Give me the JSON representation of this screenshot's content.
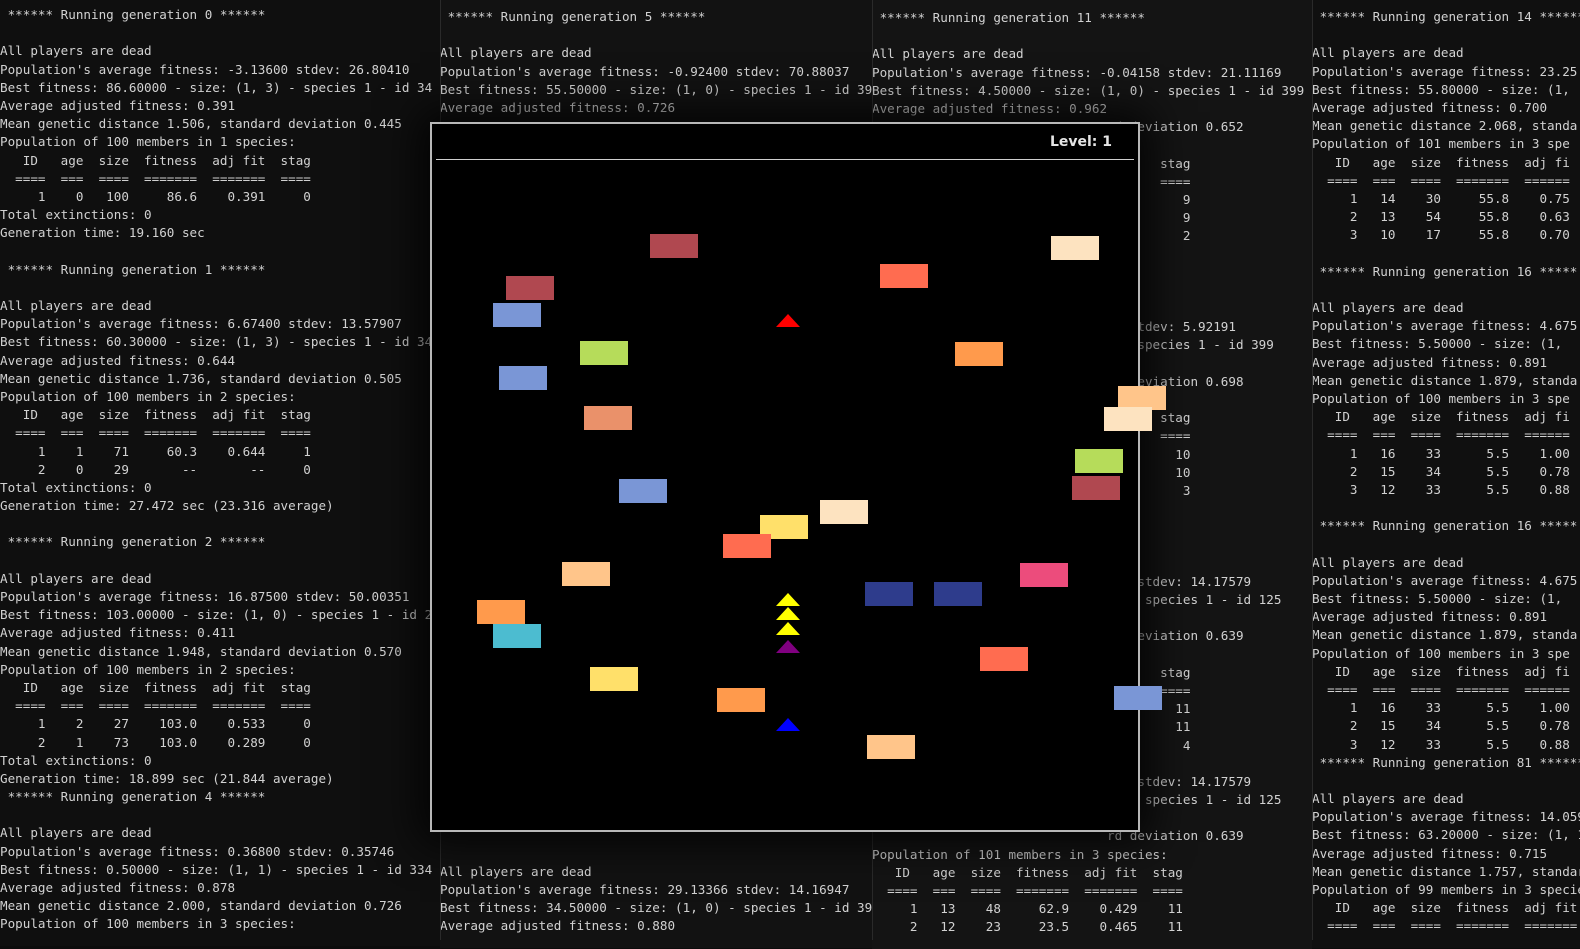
{
  "terminals": [
    {
      "lines": [
        " ****** Running generation 0 ******",
        "",
        "All players are dead",
        "Population's average fitness: -3.13600 stdev: 26.80410",
        "Best fitness: 86.60000 - size: (1, 3) - species 1 - id 34",
        "Average adjusted fitness: 0.391",
        "Mean genetic distance 1.506, standard deviation 0.445",
        "Population of 100 members in 1 species:",
        "   ID   age  size  fitness  adj fit  stag",
        "  ====  ===  ====  =======  =======  ====",
        "     1    0   100     86.6    0.391     0",
        "Total extinctions: 0",
        "Generation time: 19.160 sec",
        "",
        " ****** Running generation 1 ******",
        "",
        "All players are dead",
        "Population's average fitness: 6.67400 stdev: 13.57907",
        "Best fitness: 60.30000 - size: (1, 3) - species 1 - id 34",
        "Average adjusted fitness: 0.644",
        "Mean genetic distance 1.736, standard deviation 0.505",
        "Population of 100 members in 2 species:",
        "   ID   age  size  fitness  adj fit  stag",
        "  ====  ===  ====  =======  =======  ====",
        "     1    1    71     60.3    0.644     1",
        "     2    0    29       --       --     0",
        "Total extinctions: 0",
        "Generation time: 27.472 sec (23.316 average)",
        "",
        " ****** Running generation 2 ******",
        "",
        "All players are dead",
        "Population's average fitness: 16.87500 stdev: 50.00351",
        "Best fitness: 103.00000 - size: (1, 0) - species 1 - id 2",
        "Average adjusted fitness: 0.411",
        "Mean genetic distance 1.948, standard deviation 0.570",
        "Population of 100 members in 2 species:",
        "   ID   age  size  fitness  adj fit  stag",
        "  ====  ===  ====  =======  =======  ====",
        "     1    2    27    103.0    0.533     0",
        "     2    1    73    103.0    0.289     0",
        "Total extinctions: 0",
        "Generation time: 18.899 sec (21.844 average)",
        " ****** Running generation 4 ******",
        "",
        "All players are dead",
        "Population's average fitness: 0.36800 stdev: 0.35746",
        "Best fitness: 0.50000 - size: (1, 1) - species 1 - id 334",
        "Average adjusted fitness: 0.878",
        "Mean genetic distance 2.000, standard deviation 0.726",
        "Population of 100 members in 3 species:"
      ]
    },
    {
      "lines": [
        " ****** Running generation 5 ******",
        "",
        "All players are dead",
        "Population's average fitness: -0.92400 stdev: 70.88037",
        "Best fitness: 55.50000 - size: (1, 0) - species 1 - id 399",
        "Average adjusted fitness: 0.726",
        "",
        "",
        "",
        "",
        "",
        "",
        "",
        "",
        "",
        "",
        "",
        "",
        "",
        "",
        "",
        "",
        "",
        "",
        "",
        "",
        "",
        "",
        "",
        "",
        "",
        "",
        "",
        "",
        "",
        "",
        "",
        "",
        "",
        "",
        "",
        "",
        "",
        "",
        "",
        "",
        "",
        "All players are dead",
        "Population's average fitness: 29.13366 stdev: 14.16947",
        "Best fitness: 34.50000 - size: (1, 0) - species 1 - id 399",
        "Average adjusted fitness: 0.880"
      ]
    },
    {
      "lines": [
        " ****** Running generation 11 ******",
        "",
        "All players are dead",
        "Population's average fitness: -0.04158 stdev: 21.11169",
        "Best fitness: 4.50000 - size: (1, 0) - species 1 - id 399",
        "Average adjusted fitness: 0.962",
        "                               rd deviation 0.652",
        "                               ies:",
        "                                      stag",
        "                                      ====",
        "                                         9",
        "                                         9",
        "                                         2",
        "",
        "",
        "",
        "",
        "                               51 stdev: 5.92191",
        "                               ) - species 1 - id 399",
        "",
        "                               rd deviation 0.698",
        "                               ies:",
        "                                      stag",
        "                                      ====",
        "                                        10",
        "                                        10",
        "                                         3",
        "",
        "",
        "",
        "",
        "                               300 stdev: 14.17579",
        "                               1) - species 1 - id 125",
        "",
        "                               rd deviation 0.639",
        "                               ies:",
        "                                      stag",
        "                                      ====",
        "                                        11",
        "                                        11",
        "                                         4",
        "",
        "                               300 stdev: 14.17579",
        "                               1) - species 1 - id 125",
        "",
        "                               rd deviation 0.639",
        "Population of 101 members in 3 species:",
        "   ID   age  size  fitness  adj fit  stag",
        "  ====  ===  ====  =======  =======  ====",
        "     1   13    48     62.9    0.429    11",
        "     2   12    23     23.5    0.465    11"
      ]
    },
    {
      "lines": [
        " ****** Running generation 14 ******",
        "",
        "All players are dead",
        "Population's average fitness: 23.25",
        "Best fitness: 55.80000 - size: (1,",
        "Average adjusted fitness: 0.700",
        "Mean genetic distance 2.068, standa",
        "Population of 101 members in 3 spe",
        "   ID   age  size  fitness  adj fi",
        "  ====  ===  ====  =======  ======",
        "     1   14    30     55.8    0.75",
        "     2   13    54     55.8    0.63",
        "     3   10    17     55.8    0.70",
        "",
        " ****** Running generation 16 *****",
        "",
        "All players are dead",
        "Population's average fitness: 4.675",
        "Best fitness: 5.50000 - size: (1,",
        "Average adjusted fitness: 0.891",
        "Mean genetic distance 1.879, standa",
        "Population of 100 members in 3 spe",
        "   ID   age  size  fitness  adj fi",
        "  ====  ===  ====  =======  ======",
        "     1   16    33      5.5    1.00",
        "     2   15    34      5.5    0.78",
        "     3   12    33      5.5    0.88",
        "",
        " ****** Running generation 16 *****",
        "",
        "All players are dead",
        "Population's average fitness: 4.675",
        "Best fitness: 5.50000 - size: (1,",
        "Average adjusted fitness: 0.891",
        "Mean genetic distance 1.879, standa",
        "Population of 100 members in 3 spe",
        "   ID   age  size  fitness  adj fi",
        "  ====  ===  ====  =======  ======",
        "     1   16    33      5.5    1.00",
        "     2   15    34      5.5    0.78",
        "     3   12    33      5.5    0.88",
        " ****** Running generation 81 ******",
        "",
        "All players are dead",
        "Population's average fitness: 14.059",
        "Best fitness: 63.20000 - size: (1, 1",
        "Average adjusted fitness: 0.715",
        "Mean genetic distance 1.757, standar",
        "Population of 99 members in 3 specie",
        "   ID   age  size  fitness  adj fit",
        "  ====  ===  ====  =======  ======="
      ]
    }
  ],
  "game": {
    "level_label": "Level: 1",
    "blocks": [
      {
        "color": "#b04850"
      },
      {
        "color": "#fde3c0"
      },
      {
        "color": "#ff6c50"
      },
      {
        "color": "#b04850"
      },
      {
        "color": "#7a96d6"
      },
      {
        "color": "#b6dc5a"
      },
      {
        "color": "#ff9a4c"
      },
      {
        "color": "#7a96d6"
      },
      {
        "color": "#ea916a"
      },
      {
        "color": "#ffc58a"
      },
      {
        "color": "#fde3c0"
      },
      {
        "color": "#b6dc5a"
      },
      {
        "color": "#b04850"
      },
      {
        "color": "#7a96d6"
      },
      {
        "color": "#fde3c0"
      },
      {
        "color": "#ffe06a"
      },
      {
        "color": "#ff6c50"
      },
      {
        "color": "#ffc58a"
      },
      {
        "color": "#2e3c8c"
      },
      {
        "color": "#2e3c8c"
      },
      {
        "color": "#ec4c7c"
      },
      {
        "color": "#ff9a4c"
      },
      {
        "color": "#4cbcd0"
      },
      {
        "color": "#ffe06a"
      },
      {
        "color": "#ff6c50"
      },
      {
        "color": "#ff9a4c"
      },
      {
        "color": "#7a96d6"
      },
      {
        "color": "#ffc58a"
      }
    ],
    "players": [
      {
        "color": "#ff0000"
      },
      {
        "color": "#ffff00"
      },
      {
        "color": "#ffff00"
      },
      {
        "color": "#ffff00"
      },
      {
        "color": "#800080"
      },
      {
        "color": "#0000ff"
      }
    ]
  }
}
